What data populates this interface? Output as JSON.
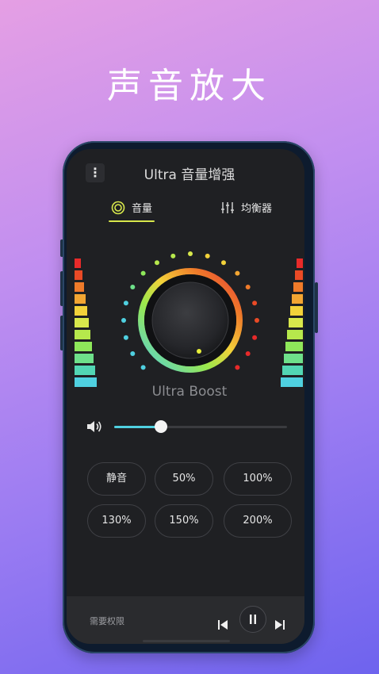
{
  "headline": "声音放大",
  "app": {
    "title": "Ultra 音量增强",
    "menu_icon": "kebab-menu-icon"
  },
  "tabs": [
    {
      "label": "音量",
      "icon": "volume-ring-icon",
      "active": true
    },
    {
      "label": "均衡器",
      "icon": "equalizer-icon",
      "active": false
    }
  ],
  "knob": {
    "label": "Ultra Boost",
    "gradient_colors": [
      "#4fd0e0",
      "#9be84c",
      "#f2d23a",
      "#ef7b2a",
      "#e8383a"
    ]
  },
  "volume": {
    "icon": "speaker-icon",
    "level": 0.27
  },
  "presets": [
    {
      "label": "静音"
    },
    {
      "label": "50%"
    },
    {
      "label": "100%"
    },
    {
      "label": "130%"
    },
    {
      "label": "150%"
    },
    {
      "label": "200%"
    }
  ],
  "bottom": {
    "permission_text": "需要权限",
    "prev_icon": "skip-previous-icon",
    "pause_icon": "pause-icon",
    "next_icon": "skip-next-icon"
  },
  "meter_colors": [
    "#e82a2a",
    "#ea4a26",
    "#ef7b2a",
    "#f2a532",
    "#f2d23a",
    "#d8e84c",
    "#b6e84c",
    "#8ee85a",
    "#6ee08a",
    "#52d6b4",
    "#4fd0e0"
  ]
}
